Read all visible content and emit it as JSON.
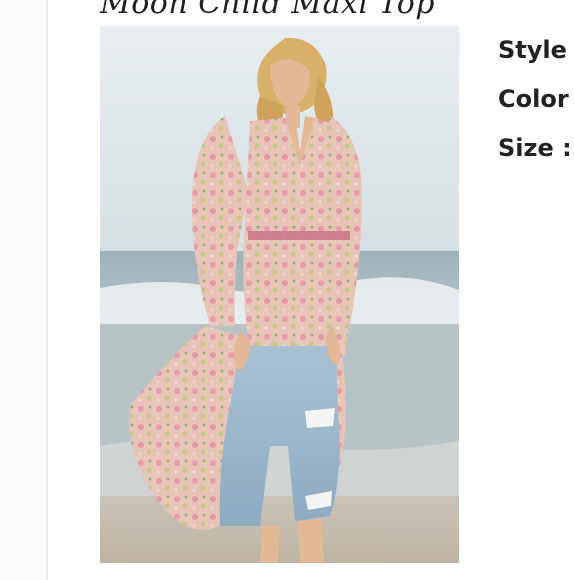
{
  "product": {
    "title": "Moon Child Maxi Top"
  },
  "details": {
    "style_label": "Style",
    "color_label": "Color",
    "size_label": "Size :"
  }
}
